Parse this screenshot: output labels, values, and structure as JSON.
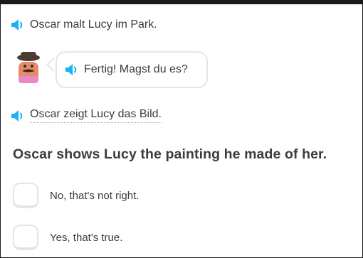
{
  "colors": {
    "speaker": "#1cb0f6",
    "text": "#3c3c3c",
    "border": "#e5e5e5"
  },
  "icons": {
    "speaker": "speaker-icon",
    "character": "oscar-avatar"
  },
  "lines": [
    {
      "text": "Oscar malt Lucy im Park."
    },
    {
      "text": "Fertig! Magst du es?"
    },
    {
      "text": "Oscar zeigt Lucy das Bild."
    }
  ],
  "question": "Oscar shows Lucy the painting he made of her.",
  "options": [
    {
      "label": "No, that's not right."
    },
    {
      "label": "Yes, that's true."
    }
  ]
}
